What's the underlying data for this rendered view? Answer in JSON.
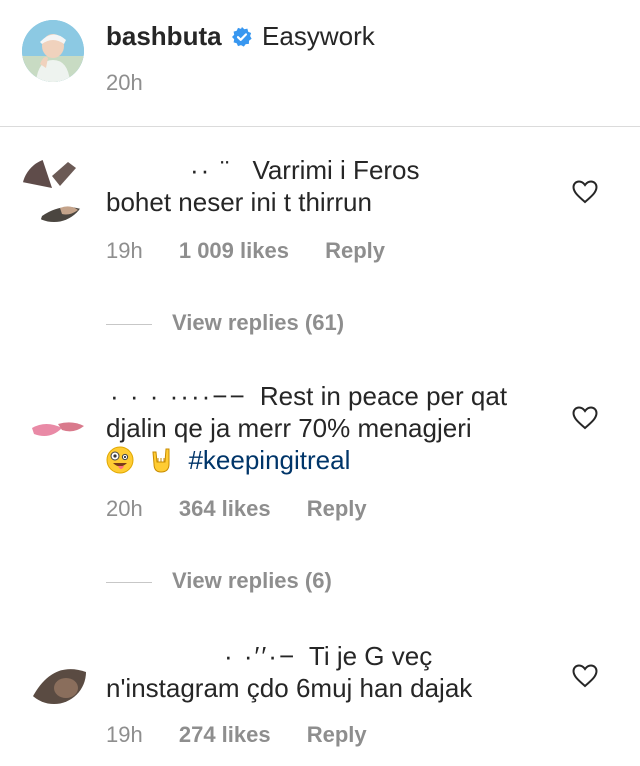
{
  "post": {
    "username": "bashbuta",
    "caption": "Easywork",
    "time": "20h"
  },
  "comments": [
    {
      "username_fragment": "·· ¨",
      "text_line1": "Varrimi i Feros",
      "text_line2": "bohet neser ini t thirrun",
      "time": "19h",
      "likes": "1 009 likes",
      "reply": "Reply",
      "view_replies": "View replies (61)"
    },
    {
      "username_fragment": "· · · ····−−",
      "text_line1": "Rest in peace per qat",
      "text_line2": "djalin qe ja merr 70% menagjeri",
      "hashtag": "#keepingitreal",
      "time": "20h",
      "likes": "364 likes",
      "reply": "Reply",
      "view_replies": "View replies (6)"
    },
    {
      "username_fragment": "· ·′′·−",
      "text_line1": "Ti je G veç",
      "text_line2": "n'instagram çdo 6muj han dajak",
      "time": "19h",
      "likes": "274 likes",
      "reply": "Reply"
    }
  ],
  "icons": {
    "verified": "verified-badge-icon",
    "heart": "heart-outline-icon",
    "emoji_crazy": "zany-face-emoji",
    "emoji_horns": "sign-of-horns-emoji"
  },
  "colors": {
    "verified_blue": "#3897f0",
    "hashtag": "#003569",
    "meta_gray": "#8e8e8e"
  }
}
